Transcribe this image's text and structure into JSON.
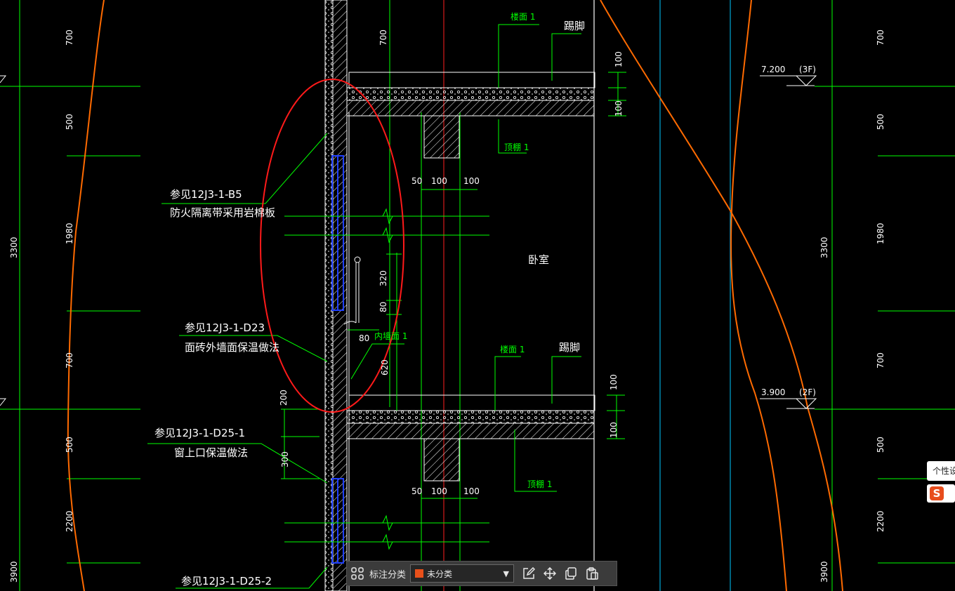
{
  "drawing": {
    "room_label": "卧室",
    "levels": [
      {
        "elev": "7.200",
        "floor": "(3F)"
      },
      {
        "elev": "3.900",
        "floor": "(2F)"
      }
    ],
    "left_dims": {
      "outer": [
        "3300",
        "3900"
      ],
      "inner": [
        "700",
        "500",
        "1980",
        "700",
        "500",
        "2200"
      ]
    },
    "right_dims": {
      "outer": [
        "3300",
        "3900"
      ],
      "inner": [
        "700",
        "500",
        "1980",
        "700",
        "500",
        "2200"
      ]
    },
    "center_dims": {
      "top": "700",
      "d320": "320",
      "d80v": "80",
      "d80h": "80",
      "d620": "620",
      "d200": "200",
      "d300": "300"
    },
    "slab_dims": {
      "top": "100",
      "bottom": "100",
      "a": "50",
      "b": "100",
      "c": "100"
    },
    "green_labels": {
      "floor1": "楼面 1",
      "skirting": "踢脚",
      "ceiling1": "顶棚 1",
      "inner_wall1": "内墙面 1"
    },
    "annotations": [
      {
        "ref": "参见12J3-1-B5",
        "desc": "防火隔离带采用岩棉板"
      },
      {
        "ref": "参见12J3-1-D23",
        "desc": "面砖外墙面保温做法"
      },
      {
        "ref": "参见12J3-1-D25-1",
        "desc": "窗上口保温做法"
      },
      {
        "ref": "参见12J3-1-D25-2",
        "desc": ""
      }
    ]
  },
  "toolbar": {
    "label": "标注分类",
    "select_value": "未分类",
    "select_color": "#e8501a"
  },
  "ime": {
    "tip": "个性设"
  }
}
